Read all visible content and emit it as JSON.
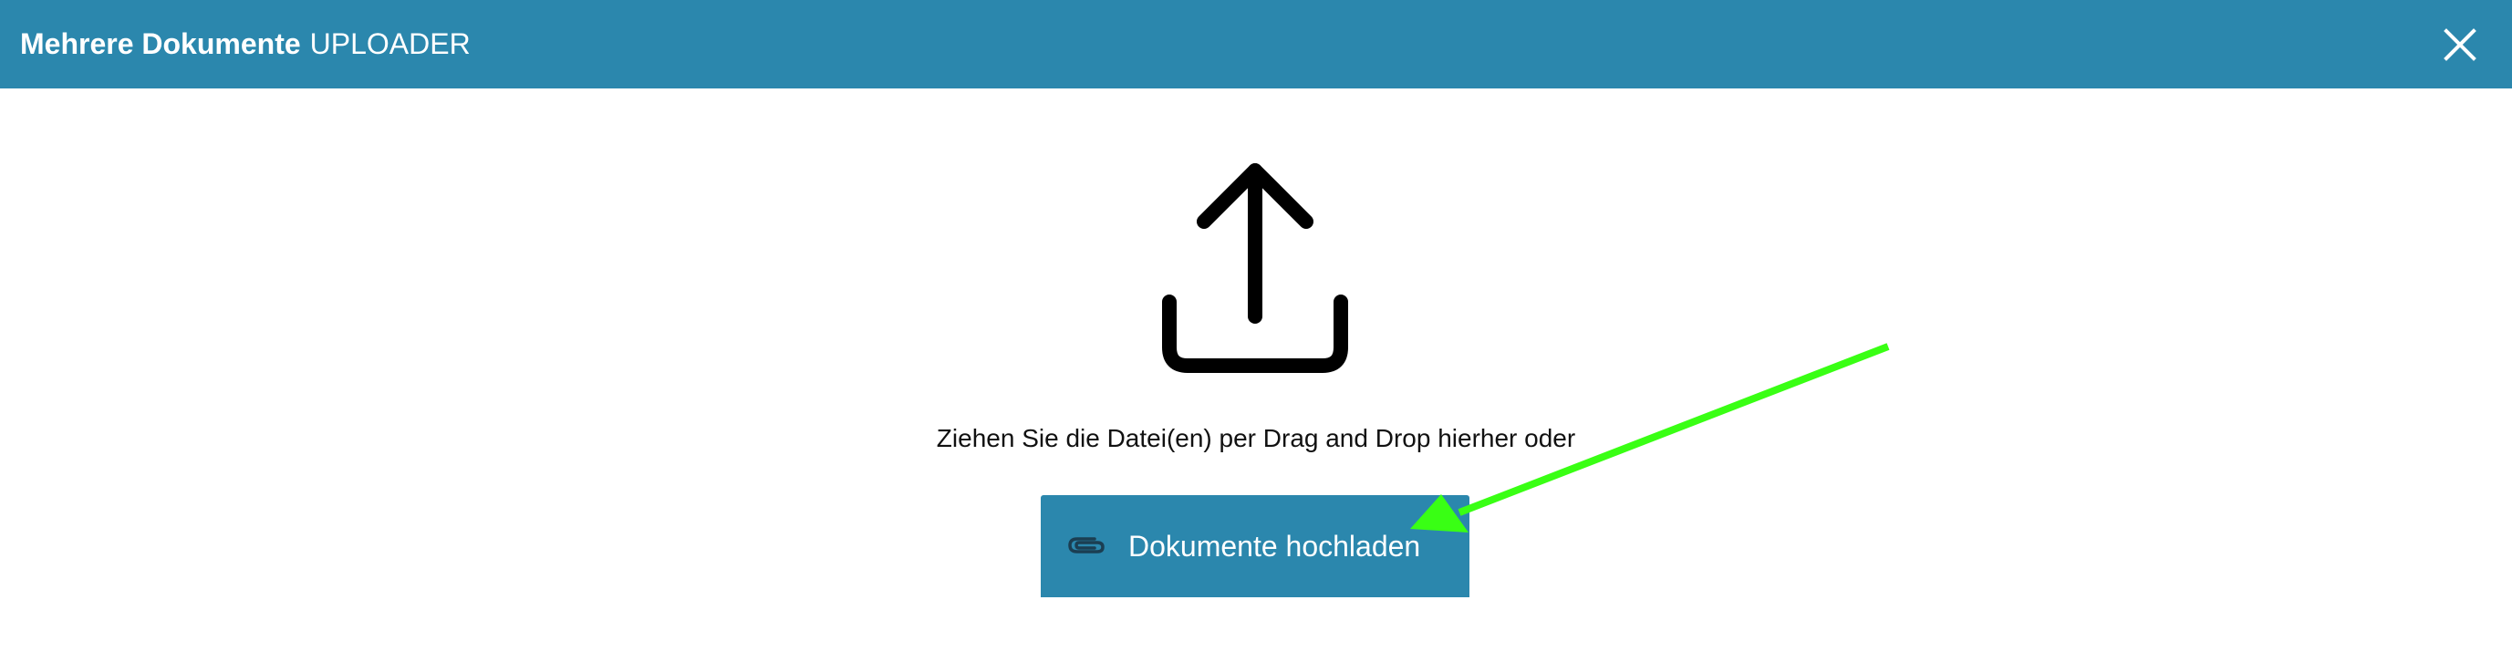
{
  "header": {
    "title_strong": "Mehrere Dokumente",
    "title_light": "UPLOADER",
    "close_icon": "close-icon"
  },
  "dropzone": {
    "icon": "upload-icon",
    "instruction": "Ziehen Sie die Datei(en) per Drag and Drop hierher oder",
    "button_icon": "paperclip-icon",
    "button_label": "Dokumente hochladen"
  },
  "annotation": {
    "type": "arrow",
    "color": "#39ff14"
  },
  "colors": {
    "primary": "#2b87ad",
    "text": "#111111",
    "background": "#ffffff",
    "button_icon": "#1b3e52"
  }
}
